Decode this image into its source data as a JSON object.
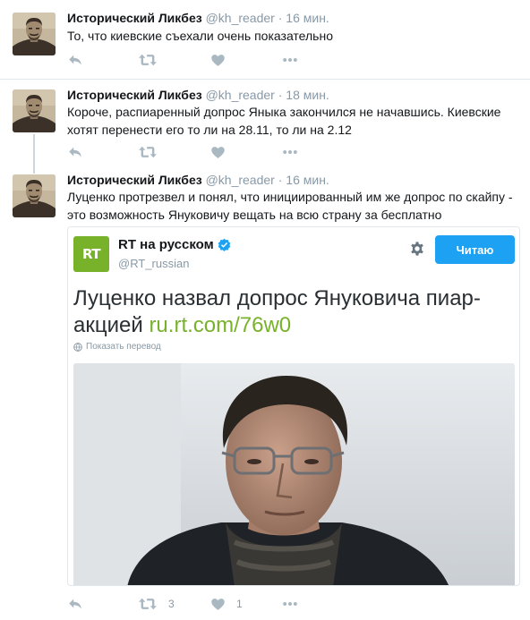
{
  "tweets": [
    {
      "name": "Исторический Ликбез",
      "handle": "@kh_reader",
      "sep": "·",
      "time": "16 мин.",
      "text": "То, что киевские съехали очень показательно",
      "retweets": "",
      "likes": ""
    },
    {
      "name": "Исторический Ликбез",
      "handle": "@kh_reader",
      "sep": "·",
      "time": "18 мин.",
      "text": "Короче, распиаренный допрос Яныка закончился не начавшись. Киевские хотят перенести его то ли на 28.11, то ли на 2.12",
      "retweets": "",
      "likes": ""
    },
    {
      "name": "Исторический Ликбез",
      "handle": "@kh_reader",
      "sep": "·",
      "time": "16 мин.",
      "text": "Луценко протрезвел и понял, что инициированный им же допрос по скайпу - это возможность Януковичу вещать на всю страну за бесплатно",
      "retweets": "3",
      "likes": "1"
    }
  ],
  "quoted": {
    "logo_text": "RT",
    "name": "RT на русском",
    "handle": "@RT_russian",
    "follow_label": "Читаю",
    "text": "Луценко назвал допрос Януковича пиар-акцией",
    "link": "ru.rt.com/76w0",
    "translate_label": "Показать перевод"
  },
  "colors": {
    "accent": "#1da1f2",
    "rt_green": "#77b22a",
    "muted": "#8899a6",
    "icon": "#aab8c2",
    "border": "#e1e8ed"
  },
  "icons": {
    "reply": "reply-icon",
    "retweet": "retweet-icon",
    "like": "heart-icon",
    "more": "more-icon",
    "gear": "gear-icon",
    "verified": "verified-badge-icon",
    "globe": "globe-icon"
  }
}
